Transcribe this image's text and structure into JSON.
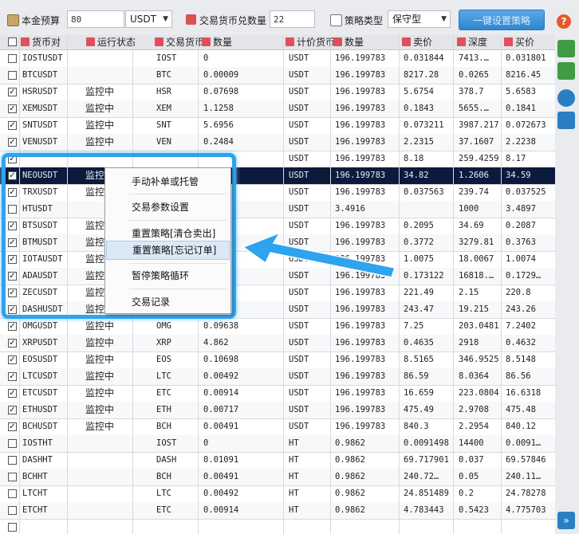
{
  "toolbar": {
    "capital_label": "本金预算",
    "capital_value": "80",
    "currency_value": "USDT",
    "coin_count_label": "交易货币兑数量",
    "coin_count_value": "22",
    "strategy_type_label": "策略类型",
    "strategy_type_value": "保守型",
    "setup_button": "一键设置策略",
    "help_label": "?"
  },
  "columns": [
    "货币对",
    "运行状态",
    "交易货币",
    "数量",
    "计价货币",
    "数量",
    "卖价",
    "深度",
    "买价"
  ],
  "rows": [
    {
      "checked": false,
      "pair": "IOSTUSDT",
      "status": "",
      "coin": "IOST",
      "qty": "0",
      "quote": "USDT",
      "qty2": "196.199783",
      "ask": "0.031844",
      "depth": "7413.…",
      "bid": "0.031801"
    },
    {
      "checked": false,
      "pair": "BTCUSDT",
      "status": "",
      "coin": "BTC",
      "qty": "0.00009",
      "quote": "USDT",
      "qty2": "196.199783",
      "ask": "8217.28",
      "depth": "0.0265",
      "bid": "8216.45"
    },
    {
      "checked": true,
      "pair": "HSRUSDT",
      "status": "监控中",
      "coin": "HSR",
      "qty": "0.07698",
      "quote": "USDT",
      "qty2": "196.199783",
      "ask": "5.6754",
      "depth": "378.7",
      "bid": "5.6583"
    },
    {
      "checked": true,
      "pair": "XEMUSDT",
      "status": "监控中",
      "coin": "XEM",
      "qty": "1.1258",
      "quote": "USDT",
      "qty2": "196.199783",
      "ask": "0.1843",
      "depth": "5655.…",
      "bid": "0.1841"
    },
    {
      "checked": true,
      "pair": "SNTUSDT",
      "status": "监控中",
      "coin": "SNT",
      "qty": "5.6956",
      "quote": "USDT",
      "qty2": "196.199783",
      "ask": "0.073211",
      "depth": "3987.217",
      "bid": "0.072673"
    },
    {
      "checked": true,
      "pair": "VENUSDT",
      "status": "监控中",
      "coin": "VEN",
      "qty": "0.2484",
      "quote": "USDT",
      "qty2": "196.199783",
      "ask": "2.2315",
      "depth": "37.1607",
      "bid": "2.2238"
    },
    {
      "checked": true,
      "pair": "",
      "status": "",
      "coin": "",
      "qty": "",
      "quote": "USDT",
      "qty2": "196.199783",
      "ask": "8.18",
      "depth": "259.4259",
      "bid": "8.17"
    },
    {
      "checked": true,
      "pair": "NEOUSDT",
      "status": "监控",
      "coin": "",
      "qty": "",
      "quote": "USDT",
      "qty2": "196.199783",
      "ask": "34.82",
      "depth": "1.2606",
      "bid": "34.59",
      "selected": true
    },
    {
      "checked": true,
      "pair": "TRXUSDT",
      "status": "监控",
      "coin": "",
      "qty": "",
      "quote": "USDT",
      "qty2": "196.199783",
      "ask": "0.037563",
      "depth": "239.74",
      "bid": "0.037525"
    },
    {
      "checked": false,
      "pair": "HTUSDT",
      "status": "",
      "coin": "",
      "qty": "",
      "quote": "USDT",
      "qty2": "3.4916",
      "ask": "",
      "depth": "1000",
      "bid": "3.4897"
    },
    {
      "checked": true,
      "pair": "BTSUSDT",
      "status": "监控",
      "coin": "",
      "qty": "",
      "quote": "USDT",
      "qty2": "196.199783",
      "ask": "0.2095",
      "depth": "34.69",
      "bid": "0.2087"
    },
    {
      "checked": true,
      "pair": "BTMUSDT",
      "status": "监控",
      "coin": "",
      "qty": "",
      "quote": "USDT",
      "qty2": "196.199783",
      "ask": "0.3772",
      "depth": "3279.81",
      "bid": "0.3763"
    },
    {
      "checked": true,
      "pair": "IOTAUSDT",
      "status": "监控",
      "coin": "",
      "qty": "",
      "quote": "USDT",
      "qty2": "196.199783",
      "ask": "1.0075",
      "depth": "18.0067",
      "bid": "1.0074"
    },
    {
      "checked": true,
      "pair": "ADAUSDT",
      "status": "监控",
      "coin": "",
      "qty": "",
      "quote": "USDT",
      "qty2": "196.199783",
      "ask": "0.173122",
      "depth": "16818.…",
      "bid": "0.1729…"
    },
    {
      "checked": true,
      "pair": "ZECUSDT",
      "status": "监控",
      "coin": "",
      "qty": "",
      "quote": "USDT",
      "qty2": "196.199783",
      "ask": "221.49",
      "depth": "2.15",
      "bid": "220.8"
    },
    {
      "checked": true,
      "pair": "DASHUSDT",
      "status": "监控",
      "coin": "",
      "qty": "",
      "quote": "USDT",
      "qty2": "196.199783",
      "ask": "243.47",
      "depth": "19.215",
      "bid": "243.26"
    },
    {
      "checked": true,
      "pair": "OMGUSDT",
      "status": "监控中",
      "coin": "OMG",
      "qty": "0.09638",
      "quote": "USDT",
      "qty2": "196.199783",
      "ask": "7.25",
      "depth": "203.0481",
      "bid": "7.2402"
    },
    {
      "checked": true,
      "pair": "XRPUSDT",
      "status": "监控中",
      "coin": "XRP",
      "qty": "4.862",
      "quote": "USDT",
      "qty2": "196.199783",
      "ask": "0.4635",
      "depth": "2918",
      "bid": "0.4632"
    },
    {
      "checked": true,
      "pair": "EOSUSDT",
      "status": "监控中",
      "coin": "EOS",
      "qty": "0.10698",
      "quote": "USDT",
      "qty2": "196.199783",
      "ask": "8.5165",
      "depth": "346.9525",
      "bid": "8.5148"
    },
    {
      "checked": true,
      "pair": "LTCUSDT",
      "status": "监控中",
      "coin": "LTC",
      "qty": "0.00492",
      "quote": "USDT",
      "qty2": "196.199783",
      "ask": "86.59",
      "depth": "8.0364",
      "bid": "86.56"
    },
    {
      "checked": true,
      "pair": "ETCUSDT",
      "status": "监控中",
      "coin": "ETC",
      "qty": "0.00914",
      "quote": "USDT",
      "qty2": "196.199783",
      "ask": "16.659",
      "depth": "223.0804",
      "bid": "16.6318"
    },
    {
      "checked": true,
      "pair": "ETHUSDT",
      "status": "监控中",
      "coin": "ETH",
      "qty": "0.00717",
      "quote": "USDT",
      "qty2": "196.199783",
      "ask": "475.49",
      "depth": "2.9708",
      "bid": "475.48"
    },
    {
      "checked": true,
      "pair": "BCHUSDT",
      "status": "监控中",
      "coin": "BCH",
      "qty": "0.00491",
      "quote": "USDT",
      "qty2": "196.199783",
      "ask": "840.3",
      "depth": "2.2954",
      "bid": "840.12"
    },
    {
      "checked": false,
      "pair": "IOSTHT",
      "status": "",
      "coin": "IOST",
      "qty": "0",
      "quote": "HT",
      "qty2": "0.9862",
      "ask": "0.0091498",
      "depth": "14400",
      "bid": "0.0091…"
    },
    {
      "checked": false,
      "pair": "DASHHT",
      "status": "",
      "coin": "DASH",
      "qty": "0.01091",
      "quote": "HT",
      "qty2": "0.9862",
      "ask": "69.717901",
      "depth": "0.037",
      "bid": "69.57846"
    },
    {
      "checked": false,
      "pair": "BCHHT",
      "status": "",
      "coin": "BCH",
      "qty": "0.00491",
      "quote": "HT",
      "qty2": "0.9862",
      "ask": "240.72…",
      "depth": "0.05",
      "bid": "240.11…"
    },
    {
      "checked": false,
      "pair": "LTCHT",
      "status": "",
      "coin": "LTC",
      "qty": "0.00492",
      "quote": "HT",
      "qty2": "0.9862",
      "ask": "24.851489",
      "depth": "0.2",
      "bid": "24.78278"
    },
    {
      "checked": false,
      "pair": "ETCHT",
      "status": "",
      "coin": "ETC",
      "qty": "0.00914",
      "quote": "HT",
      "qty2": "0.9862",
      "ask": "4.783443",
      "depth": "0.5423",
      "bid": "4.775703"
    },
    {
      "checked": false,
      "pair": "",
      "status": "",
      "coin": "",
      "qty": "",
      "quote": "",
      "qty2": "",
      "ask": "",
      "depth": "",
      "bid": ""
    }
  ],
  "context_menu": {
    "items": [
      "手动补单或托管",
      "交易参数设置",
      "重置策略[清仓卖出]",
      "重置策略[忘记订单]",
      "暂停策略循环",
      "交易记录"
    ]
  },
  "colors": {
    "selected_row": "#0c1a3c",
    "accent_blue": "#2ea3ef",
    "header_icon": "#e04f5f",
    "setup_button": "#2f86d0"
  }
}
